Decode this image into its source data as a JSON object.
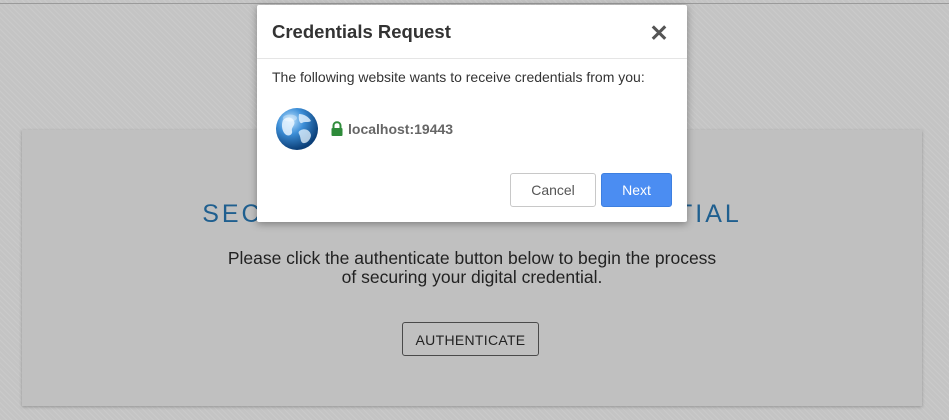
{
  "page": {
    "card_title": "SECURE YOUR DIGITAL CREDENTIAL",
    "description": "Please click the authenticate button below to begin the process of securing your digital credential.",
    "authenticate_label": "AUTHENTICATE"
  },
  "dialog": {
    "title": "Credentials Request",
    "close_glyph": "✕",
    "message": "The following website wants to receive credentials from you:",
    "site_icon": "globe-icon",
    "secure_icon": "lock-icon",
    "host": "localhost:19443",
    "cancel_label": "Cancel",
    "next_label": "Next"
  },
  "colors": {
    "accent": "#4b8df2",
    "title_blue": "#1f5f8f",
    "lock_green": "#2e8b3a"
  }
}
